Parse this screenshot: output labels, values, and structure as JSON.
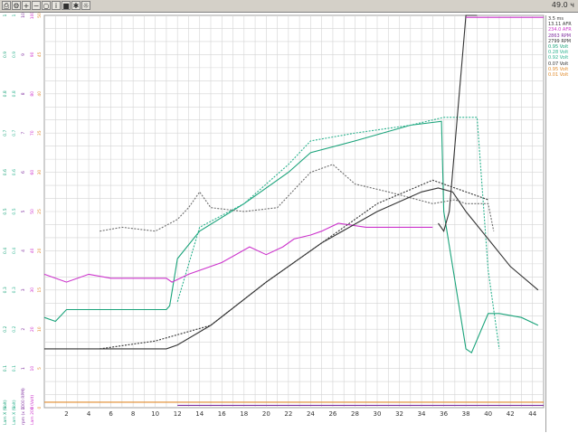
{
  "toolbar": {
    "buttons": [
      "print-icon",
      "settings-icon",
      "zoom-in-icon",
      "zoom-out-icon",
      "zoom-reset-icon",
      "info-icon",
      "note-icon",
      "star-icon",
      "gear-icon"
    ],
    "status_text": "49.0 ч"
  },
  "colors": {
    "grid": "#d4d4d4",
    "green": "#1aa37a",
    "teal_dotted": "#2db38f",
    "magenta": "#cc33cc",
    "gray_dotted": "#6e6e6e",
    "dark": "#333333",
    "orange": "#e08a2a",
    "purple": "#8030a0"
  },
  "chart_data": {
    "type": "line",
    "xlim": [
      0,
      45
    ],
    "ylim": [
      0,
      100
    ],
    "x_ticks": [
      2,
      4,
      6,
      8,
      10,
      12,
      14,
      16,
      18,
      20,
      22,
      24,
      26,
      28,
      30,
      32,
      34,
      36,
      38,
      40,
      42,
      44
    ],
    "y_axes": [
      {
        "label": "Lam X (Volt)",
        "color": "#1aa37a",
        "ticks": [
          "0",
          "0.1",
          "0.2",
          "0.3",
          "0.4",
          "0.5",
          "0.6",
          "0.7",
          "0.8",
          "0.9",
          "1"
        ]
      },
      {
        "label": "Lam X (Volt)",
        "color": "#2db38f",
        "ticks": [
          "0",
          "0.1",
          "0.2",
          "0.3",
          "0.4",
          "0.5",
          "0.6",
          "0.7",
          "0.8",
          "0.9",
          "1"
        ]
      },
      {
        "label": "rpm (x 1000 RPM)",
        "color": "#8030a0",
        "ticks": [
          "0",
          "1",
          "2",
          "3",
          "4",
          "5",
          "6",
          "7",
          "8",
          "9",
          "10"
        ]
      },
      {
        "label": "Lam 200 (Volt)",
        "color": "#cc33cc",
        "ticks": [
          "0",
          "10",
          "20",
          "30",
          "40",
          "50",
          "60",
          "70",
          "80",
          "90",
          "100"
        ]
      },
      {
        "label": "",
        "color": "#e08a2a",
        "ticks": [
          "0",
          "5",
          "10",
          "15",
          "20",
          "25",
          "30",
          "35",
          "40",
          "45",
          "50"
        ]
      }
    ],
    "series": [
      {
        "color": "#1aa37a",
        "style": "solid",
        "x": [
          0,
          1,
          2,
          5,
          11,
          11.3,
          12,
          14,
          18,
          22,
          24,
          28,
          33,
          35.8,
          36,
          38,
          38.5,
          40,
          41,
          43,
          44.5
        ],
        "y": [
          23,
          22,
          25,
          25,
          25,
          26,
          38,
          45,
          52,
          60,
          65,
          68,
          72,
          73,
          50,
          15,
          14,
          24,
          24,
          23,
          21
        ]
      },
      {
        "color": "#2db38f",
        "style": "dotted",
        "x": [
          12,
          14,
          18,
          22,
          24,
          28,
          33,
          36,
          39,
          40,
          41
        ],
        "y": [
          27,
          46,
          52,
          62,
          68,
          70,
          72,
          74,
          74,
          35,
          15
        ]
      },
      {
        "color": "#cc33cc",
        "style": "solid",
        "x": [
          0,
          2,
          4,
          6,
          11,
          11.5,
          13,
          16,
          18.5,
          20,
          21.5,
          22.5,
          24,
          25,
          26.5,
          29,
          32,
          35
        ],
        "y": [
          34,
          32,
          34,
          33,
          33,
          32,
          34,
          37,
          41,
          39,
          41,
          43,
          44,
          45,
          47,
          46,
          46,
          46
        ]
      },
      {
        "color": "#6e6e6e",
        "style": "dotted",
        "x": [
          5,
          7,
          10,
          12,
          13,
          14,
          15,
          18,
          21,
          23,
          24,
          26,
          28,
          31,
          35,
          37,
          38,
          40,
          40.5
        ],
        "y": [
          45,
          46,
          45,
          48,
          51,
          55,
          51,
          50,
          51,
          57,
          60,
          62,
          57,
          55,
          52,
          53,
          52,
          52,
          45
        ]
      },
      {
        "color": "#333333",
        "style": "dotted",
        "x": [
          5,
          10,
          15,
          20,
          25,
          30,
          35,
          39,
          40
        ],
        "y": [
          15,
          17,
          21,
          32,
          42,
          52,
          58,
          54,
          53
        ]
      },
      {
        "color": "#333333",
        "style": "solid",
        "x": [
          0,
          11,
          12,
          15,
          20,
          25,
          30,
          34,
          35.5,
          36.8,
          38,
          40,
          42,
          44.5
        ],
        "y": [
          15,
          15,
          16,
          21,
          32,
          42,
          50,
          55,
          56,
          55,
          50,
          43,
          36,
          30
        ]
      },
      {
        "color": "#333333",
        "style": "solid",
        "x": [
          35.5,
          36,
          36.5,
          38,
          39
        ],
        "y": [
          47,
          45,
          50,
          100,
          100
        ]
      },
      {
        "color": "#cc33cc",
        "style": "solid",
        "x": [
          38,
          45
        ],
        "y": [
          99.5,
          99.5
        ]
      },
      {
        "color": "#e08a2a",
        "style": "solid",
        "x": [
          0,
          45
        ],
        "y": [
          1.4,
          1.4
        ]
      },
      {
        "color": "#8030a0",
        "style": "solid",
        "x": [
          12,
          45
        ],
        "y": [
          0.6,
          0.6
        ]
      }
    ],
    "legend_position": "right",
    "legend": [
      {
        "text": "3.5 ms",
        "color": "#333333"
      },
      {
        "text": "13.11 AFR",
        "color": "#333333"
      },
      {
        "text": "234.0 AFR",
        "color": "#cc33cc"
      },
      {
        "text": "2863 RPM",
        "color": "#8030a0"
      },
      {
        "text": "2799 RPM",
        "color": "#333333"
      },
      {
        "text": "0.95 Volt",
        "color": "#1aa37a"
      },
      {
        "text": "0.28 Volt",
        "color": "#2db38f"
      },
      {
        "text": "0.92 Volt",
        "color": "#2db38f"
      },
      {
        "text": "0.07 Volt",
        "color": "#333333"
      },
      {
        "text": "0.95 Volt",
        "color": "#e08a2a"
      },
      {
        "text": "0.01 Volt",
        "color": "#e08a2a"
      }
    ]
  }
}
